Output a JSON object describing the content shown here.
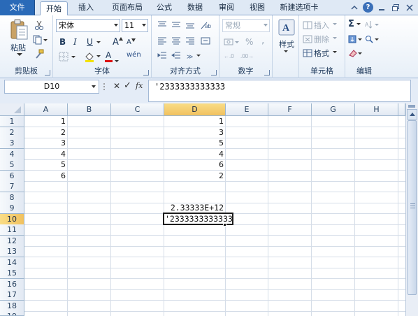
{
  "ribbon_tabs": [
    {
      "label": "文件"
    },
    {
      "label": "开始"
    },
    {
      "label": "插入"
    },
    {
      "label": "页面布局"
    },
    {
      "label": "公式"
    },
    {
      "label": "数据"
    },
    {
      "label": "审阅"
    },
    {
      "label": "视图"
    },
    {
      "label": "新建选项卡"
    }
  ],
  "window_controls": {
    "help": "?"
  },
  "clipboard": {
    "paste_label": "粘贴",
    "group_label": "剪贴板"
  },
  "font": {
    "family": "宋体",
    "size": "11",
    "bold": "B",
    "italic": "I",
    "underline": "U",
    "grow": "A",
    "shrink": "A",
    "font_color": "A",
    "phonetic": "wén",
    "group_label": "字体"
  },
  "alignment": {
    "group_label": "对齐方式"
  },
  "number": {
    "format": "常规",
    "percent": "%",
    "comma": ",",
    "group_label": "数字"
  },
  "styles": {
    "label": "样式"
  },
  "cells": {
    "insert": "插入",
    "delete": "删除",
    "format": "格式",
    "group_label": "单元格"
  },
  "editing": {
    "sum": "Σ",
    "group_label": "编辑"
  },
  "formula_bar": {
    "name_box": "D10",
    "cancel": "✕",
    "enter": "✓",
    "fx": "fx",
    "value": "'2333333333333"
  },
  "columns": [
    "A",
    "B",
    "C",
    "D",
    "E",
    "F",
    "G",
    "H"
  ],
  "rows": [
    "1",
    "2",
    "3",
    "4",
    "5",
    "6",
    "7",
    "8",
    "9",
    "10",
    "11",
    "12",
    "13",
    "14",
    "15",
    "16",
    "17",
    "18",
    "19"
  ],
  "selected": {
    "column": "D",
    "row": "10"
  },
  "cells_data": {
    "A1": "1",
    "A2": "2",
    "A3": "3",
    "A4": "4",
    "A5": "5",
    "A6": "6",
    "D1": "1",
    "D2": "3",
    "D3": "5",
    "D4": "4",
    "D5": "6",
    "D6": "2",
    "D9": "2.33333E+12",
    "D10": "'2333333333333"
  },
  "colors": {
    "file_tab": "#2a6ab8",
    "selected_header": "#f1c15f",
    "gridline": "#d5dde8"
  }
}
